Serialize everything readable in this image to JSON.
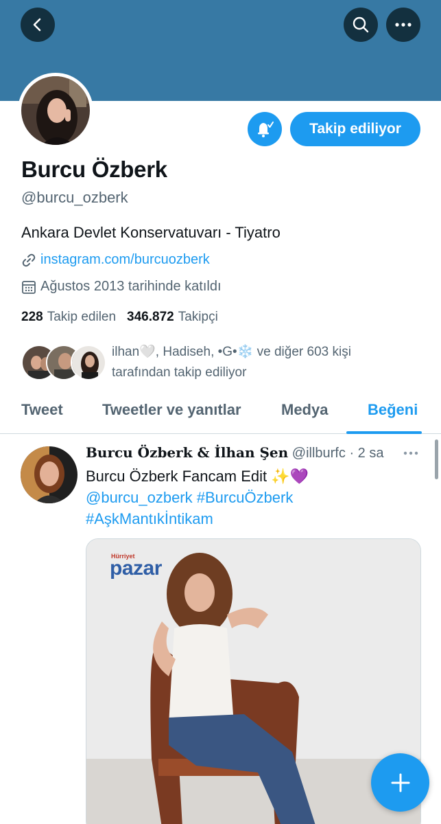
{
  "profile": {
    "name": "Burcu Özberk",
    "handle": "@burcu_ozberk",
    "bio": "Ankara Devlet Konservatuvarı - Tiyatro",
    "website": "instagram.com/burcuozberk",
    "joined": "Ağustos 2013 tarihinde katıldı",
    "following_count": "228",
    "following_label": "Takip edilen",
    "followers_count": "346.872",
    "followers_label": "Takipçi",
    "followed_by_line1": "ilhan🤍, Hadiseh, •G•❄️ ve diğer 603 kişi",
    "followed_by_line2": "tarafından takip ediliyor"
  },
  "actions": {
    "follow_label": "Takip ediliyor"
  },
  "header": {
    "back_icon": "back-arrow-icon",
    "search_icon": "search-icon",
    "more_icon": "more-horizontal-icon"
  },
  "tabs": [
    {
      "label": "Tweet"
    },
    {
      "label": "Tweetler ve yanıtlar"
    },
    {
      "label": "Medya"
    },
    {
      "label": "Beğeni"
    }
  ],
  "tweet": {
    "author": "Burcu Özberk & İlhan Şen",
    "handle": "@illburfc",
    "time": "· 2 sa",
    "text": "Burcu Özberk Fancam Edit ✨💜",
    "mentions": "@burcu_ozberk #BurcuÖzberk",
    "hashtag2": "#AşkMantıkİntikam",
    "media_brand": "pazar",
    "media_brand_top": "Hürriyet"
  },
  "colors": {
    "accent": "#1d9bf0",
    "banner": "#3779a4",
    "text_primary": "#0f1419",
    "text_secondary": "#536471"
  }
}
